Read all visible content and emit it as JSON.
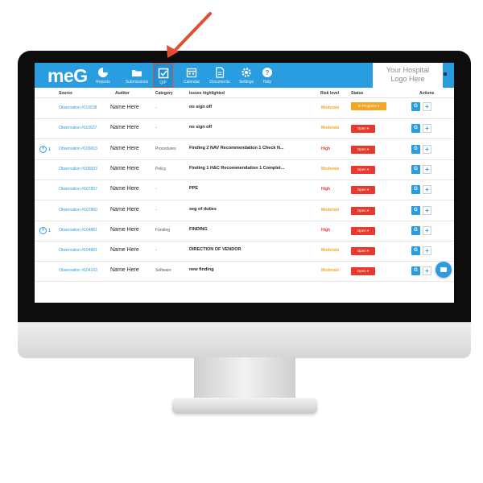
{
  "app": {
    "logo": "meG",
    "hospital_logo": [
      "Your Hospital",
      "Logo Here"
    ]
  },
  "nav": [
    {
      "label": "Reports",
      "icon": "reports-icon"
    },
    {
      "label": "Submissions",
      "icon": "folder-icon"
    },
    {
      "label": "QIP",
      "icon": "checkbox-icon",
      "active": true
    },
    {
      "label": "Calendar",
      "icon": "calendar-icon"
    },
    {
      "label": "Documents",
      "icon": "document-icon"
    },
    {
      "label": "Settings",
      "icon": "gear-icon"
    },
    {
      "label": "Help",
      "icon": "help-icon"
    }
  ],
  "table": {
    "headers": [
      "Source",
      "Auditor",
      "Category",
      "Issues highlighted",
      "Risk level",
      "Status",
      "Actions"
    ],
    "rows": [
      {
        "expand": "",
        "source": "Observation #110638",
        "auditor": "Name Here",
        "category": "-",
        "issue": "no sign off",
        "risk": "Moderate",
        "status": "In Progress ▾"
      },
      {
        "expand": "",
        "source": "Observation #110637",
        "auditor": "Name Here",
        "category": "-",
        "issue": "no sign off",
        "risk": "Moderate",
        "status": "Open ▾"
      },
      {
        "expand": "1",
        "source": "Observation #106003",
        "auditor": "Name Here",
        "category": "Procedures",
        "issue": "Finding 2 NAV Recommendation 1 Check N...",
        "risk": "High",
        "status": "Open ▾"
      },
      {
        "expand": "",
        "source": "Observation #106003",
        "auditor": "Name Here",
        "category": "Policy",
        "issue": "Finding 1 H&C Recommendation 1 Complet...",
        "risk": "Moderate",
        "status": "Open ▾"
      },
      {
        "expand": "",
        "source": "Observation #107897",
        "auditor": "Name Here",
        "category": "-",
        "issue": "PPE",
        "risk": "High",
        "status": "Open ▾"
      },
      {
        "expand": "",
        "source": "Observation #107860",
        "auditor": "Name Here",
        "category": "-",
        "issue": "seg of duties",
        "risk": "Moderate",
        "status": "Open ▾"
      },
      {
        "expand": "1",
        "source": "Observation #104881",
        "auditor": "Name Here",
        "category": "Funding",
        "issue": "FINDING",
        "risk": "High",
        "status": "Open ▾"
      },
      {
        "expand": "",
        "source": "Observation #104881",
        "auditor": "Name Here",
        "category": "-",
        "issue": "DIRECTION OF VENDOR",
        "risk": "Moderate",
        "status": "Open ▾"
      },
      {
        "expand": "",
        "source": "Observation #104163",
        "auditor": "Name Here",
        "category": "Software",
        "issue": "new finding",
        "risk": "Moderate",
        "status": "Open ▾"
      }
    ],
    "action_g": "G",
    "action_plus": "+"
  },
  "colors": {
    "brand": "#2a9de1",
    "moderate": "#f5a623",
    "high": "#e8392c",
    "open": "#e8392c",
    "in_progress": "#f5a623",
    "arrow": "#e14e34"
  }
}
